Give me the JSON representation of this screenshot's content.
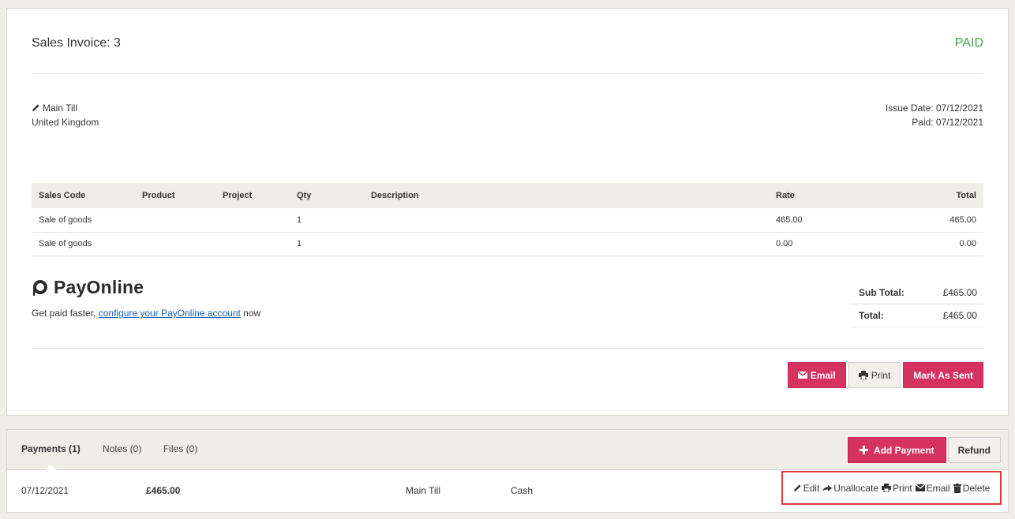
{
  "invoice": {
    "title": "Sales Invoice: 3",
    "status": "PAID",
    "customer": {
      "name": "Main Till",
      "country": "United Kingdom"
    },
    "issue_date": "Issue Date: 07/12/2021",
    "paid_date": "Paid: 07/12/2021",
    "table": {
      "headers": [
        "Sales Code",
        "Product",
        "Project",
        "Qty",
        "Description",
        "Rate",
        "Total"
      ],
      "rows": [
        [
          "Sale of goods",
          "",
          "",
          "1",
          "",
          "465.00",
          "465.00"
        ],
        [
          "Sale of goods",
          "",
          "",
          "1",
          "",
          "0.00",
          "0.00"
        ]
      ]
    },
    "payonline": {
      "logo_text": "PayOnline",
      "cta_prefix": "Get paid faster, ",
      "cta_link": "configure your PayOnline account",
      "cta_suffix": " now"
    },
    "totals": {
      "subtotal_label": "Sub Total:",
      "subtotal_value": "£465.00",
      "total_label": "Total:",
      "total_value": "£465.00"
    },
    "actions": {
      "email": "Email",
      "print": "Print",
      "mark_sent": "Mark As Sent"
    }
  },
  "payments": {
    "tabs": [
      "Payments (1)",
      "Notes (0)",
      "Files (0)"
    ],
    "add_payment": "Add Payment",
    "refund": "Refund",
    "row": {
      "date": "07/12/2021",
      "amount": "£465.00",
      "account": "Main Till",
      "method": "Cash"
    },
    "row_actions": {
      "edit": "Edit",
      "unallocate": "Unallocate",
      "print": "Print",
      "email": "Email",
      "delete": "Delete"
    }
  },
  "colors": {
    "primary": "#d6325f",
    "paid": "#3aa74a",
    "highlight": "#e0393e",
    "link": "#1a5fb4"
  },
  "icons": [
    "pencil-icon",
    "envelope-icon",
    "printer-icon",
    "plus-icon",
    "share-icon",
    "trash-icon",
    "payonline-logo-icon"
  ]
}
